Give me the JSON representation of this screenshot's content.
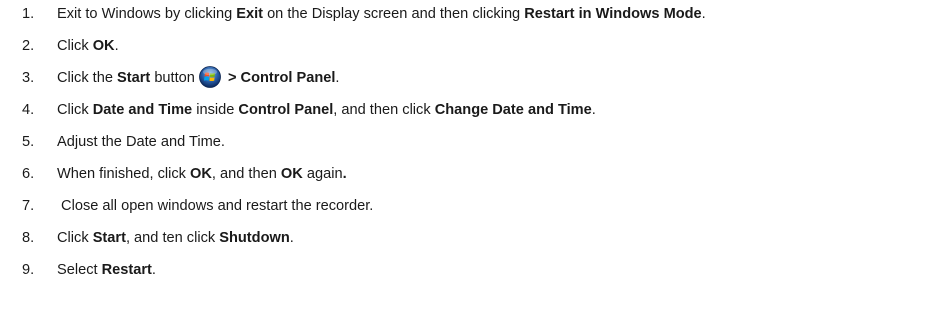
{
  "steps": [
    {
      "number": "1.",
      "parts": [
        {
          "text": "Exit to Windows by clicking ",
          "bold": false
        },
        {
          "text": "Exit",
          "bold": true
        },
        {
          "text": " on the Display screen and then clicking ",
          "bold": false
        },
        {
          "text": "Restart in Windows Mode",
          "bold": true
        },
        {
          "text": ".",
          "bold": false
        }
      ]
    },
    {
      "number": "2.",
      "parts": [
        {
          "text": "Click ",
          "bold": false
        },
        {
          "text": "OK",
          "bold": true
        },
        {
          "text": ".",
          "bold": false
        }
      ]
    },
    {
      "number": "3.",
      "parts": [
        {
          "text": "Click the ",
          "bold": false
        },
        {
          "text": "Start",
          "bold": true
        },
        {
          "text": " button",
          "bold": false
        },
        {
          "icon": "windows-start-orb-icon"
        },
        {
          "text": " > Control Panel",
          "bold": true
        },
        {
          "text": ".",
          "bold": false
        }
      ]
    },
    {
      "number": "4.",
      "parts": [
        {
          "text": "Click ",
          "bold": false
        },
        {
          "text": "Date and Time",
          "bold": true
        },
        {
          "text": " inside ",
          "bold": false
        },
        {
          "text": "Control Panel",
          "bold": true
        },
        {
          "text": ", and then click ",
          "bold": false
        },
        {
          "text": "Change Date and Time",
          "bold": true
        },
        {
          "text": ".",
          "bold": false
        }
      ]
    },
    {
      "number": "5.",
      "parts": [
        {
          "text": "Adjust the Date and Time.",
          "bold": false
        }
      ]
    },
    {
      "number": "6.",
      "parts": [
        {
          "text": "When finished, click ",
          "bold": false
        },
        {
          "text": "OK",
          "bold": true
        },
        {
          "text": ", and then ",
          "bold": false
        },
        {
          "text": "OK",
          "bold": true
        },
        {
          "text": " again",
          "bold": false
        },
        {
          "text": ".",
          "bold": true
        }
      ]
    },
    {
      "number": "7.",
      "parts": [
        {
          "text": " Close all open windows and restart the recorder.",
          "bold": false
        }
      ]
    },
    {
      "number": "8.",
      "parts": [
        {
          "text": "Click ",
          "bold": false
        },
        {
          "text": "Start",
          "bold": true
        },
        {
          "text": ", and ten click ",
          "bold": false
        },
        {
          "text": "Shutdown",
          "bold": true
        },
        {
          "text": ".",
          "bold": false
        }
      ]
    },
    {
      "number": "9.",
      "parts": [
        {
          "text": "Select ",
          "bold": false
        },
        {
          "text": "Restart",
          "bold": true
        },
        {
          "text": ".",
          "bold": false
        }
      ]
    }
  ]
}
